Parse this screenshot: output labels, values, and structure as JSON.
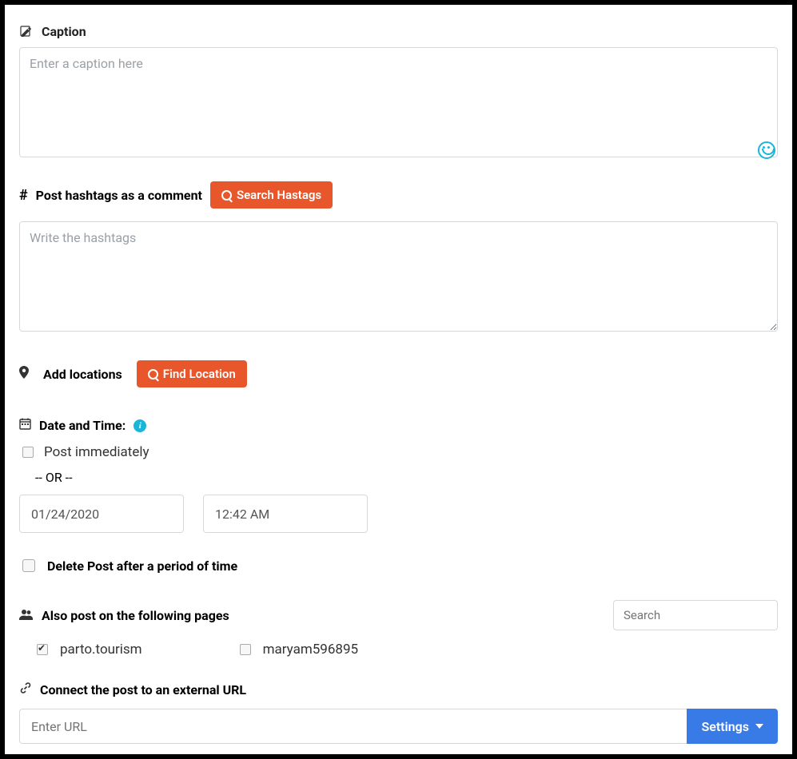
{
  "caption": {
    "label": "Caption",
    "placeholder": "Enter a caption here",
    "value": ""
  },
  "hashtags": {
    "label": "Post hashtags as a comment",
    "search_btn": "Search Hastags",
    "placeholder": "Write the hashtags",
    "value": ""
  },
  "locations": {
    "label": "Add locations",
    "find_btn": "Find Location"
  },
  "datetime": {
    "label": "Date and Time:",
    "post_immediately_label": "Post immediately",
    "post_immediately_checked": false,
    "or_text": "-- OR --",
    "date_value": "01/24/2020",
    "time_value": "12:42 AM"
  },
  "delete_after": {
    "label": "Delete Post after a period of time",
    "checked": false
  },
  "also_post": {
    "label": "Also post on the following pages",
    "search_placeholder": "Search",
    "pages": [
      {
        "name": "parto.tourism",
        "checked": true
      },
      {
        "name": "maryam596895",
        "checked": false
      }
    ]
  },
  "external_url": {
    "label": "Connect the post to an external URL",
    "placeholder": "Enter URL",
    "value": "",
    "settings_btn": "Settings"
  }
}
